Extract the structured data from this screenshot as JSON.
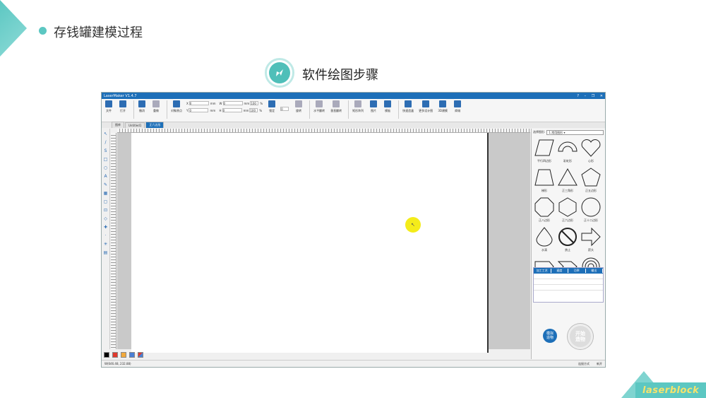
{
  "slide": {
    "title": "存钱罐建模过程",
    "subtitle": "软件绘图步骤",
    "brand": "laserblock"
  },
  "app": {
    "window_title": "LaserMaker V1.4.7",
    "window_controls": [
      "?",
      "–",
      "❐",
      "✕"
    ],
    "toolbar": {
      "file": "文件",
      "open": "打开",
      "undo": "撤消",
      "redo": "重做",
      "object_props": "对象原点",
      "lock": "锁定",
      "rotate": "旋转",
      "mirror_h": "水平翻转",
      "mirror_v": "垂直翻转",
      "array": "矩形阵列",
      "image": "图片",
      "model": "模板",
      "quick_box": "快速造盒",
      "more_design": "更多设计图",
      "model_3d": "3D建模",
      "shop": "商城",
      "x_label": "X",
      "y_label": "Y",
      "w_label": "W",
      "h_label": "H",
      "x_val": "0",
      "y_val": "0",
      "w_val": "0",
      "h_val": "0",
      "unit": "mm",
      "pct1": "100",
      "pct2": "100",
      "pct_unit": "%",
      "angle_val": "0"
    },
    "tabs": [
      {
        "label": "图库",
        "active": false
      },
      {
        "label": "Untitled1",
        "active": false
      },
      {
        "label": "正六边形",
        "active": true
      }
    ],
    "right_panel": {
      "select_label": "选择图形:",
      "select_value": "1.常用图形",
      "shapes": [
        {
          "label": "平行四边形",
          "shape": "parallelogram"
        },
        {
          "label": "彩虹形",
          "shape": "arch"
        },
        {
          "label": "心形",
          "shape": "heart"
        },
        {
          "label": "梯形",
          "shape": "trapezoid"
        },
        {
          "label": "正三角形",
          "shape": "triangle"
        },
        {
          "label": "正五边形",
          "shape": "pentagon"
        },
        {
          "label": "正八边形",
          "shape": "octagon"
        },
        {
          "label": "正六边形",
          "shape": "hexagon"
        },
        {
          "label": "正十二边形",
          "shape": "dodecagon"
        },
        {
          "label": "水滴",
          "shape": "drop"
        },
        {
          "label": "禁止",
          "shape": "forbidden"
        },
        {
          "label": "箭头",
          "shape": "arrow"
        },
        {
          "label": "",
          "shape": "tag"
        },
        {
          "label": "",
          "shape": "chevron"
        },
        {
          "label": "",
          "shape": "spiral"
        }
      ],
      "process_headers": [
        "加工工艺",
        "速度",
        "功率",
        "输出"
      ],
      "simulate": "模拟\n造物",
      "start": "开始\n造物",
      "status_mode": "连接方式",
      "status_new": "新开"
    },
    "status": {
      "coords": "W(646.48, 232.88)"
    },
    "palette": [
      "#000000",
      "#e03a2e",
      "#f2a93b",
      "#4a7fd4",
      "#multi"
    ]
  }
}
